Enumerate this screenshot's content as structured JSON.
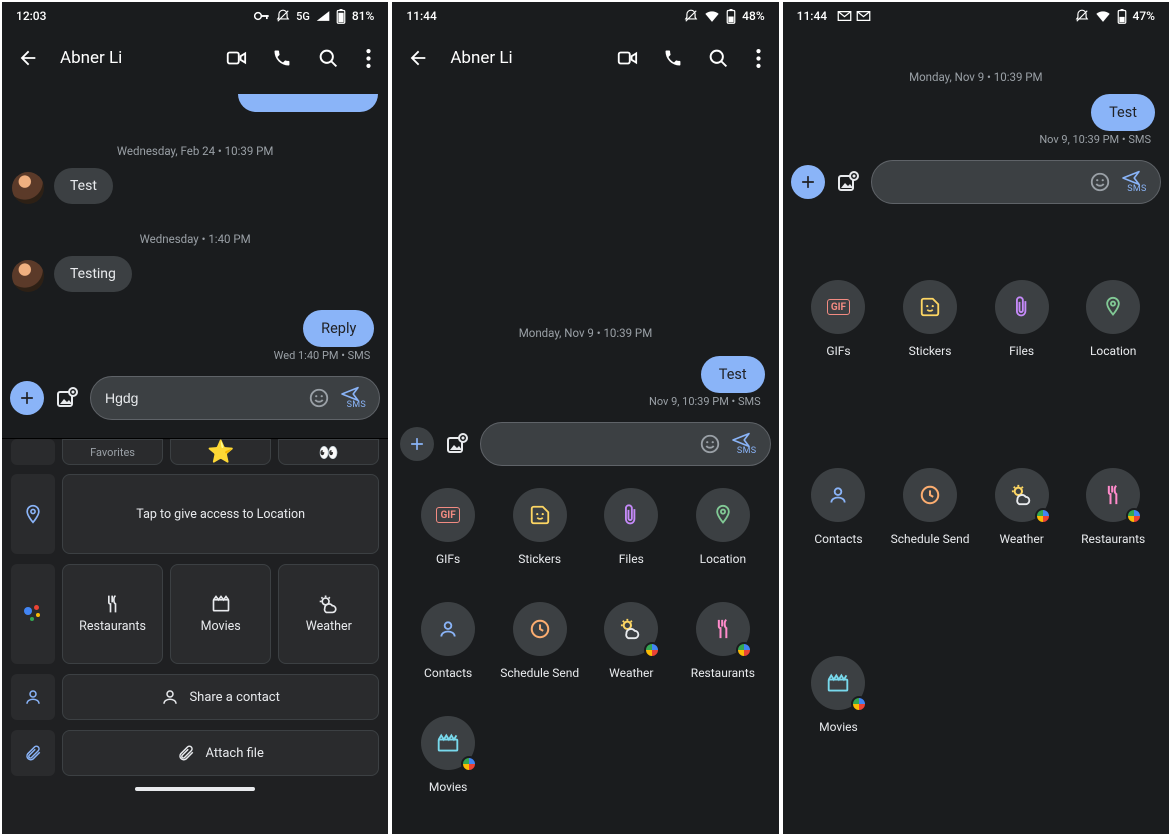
{
  "screen1": {
    "status": {
      "time": "12:03",
      "net": "5G",
      "battery": "81%"
    },
    "contact": "Abner Li",
    "date1": "Wednesday, Feb 24 • 10:39 PM",
    "msg1": "Test",
    "date2": "Wednesday • 1:40 PM",
    "msg2": "Testing",
    "reply": "Reply",
    "reply_meta": "Wed 1:40 PM • SMS",
    "input_value": "Hgdg",
    "send_label": "SMS",
    "panel": {
      "favorites": "Favorites",
      "location_prompt": "Tap to give access to Location",
      "restaurants": "Restaurants",
      "movies": "Movies",
      "weather": "Weather",
      "share_contact": "Share a contact",
      "attach_file": "Attach file"
    }
  },
  "screen2": {
    "status": {
      "time": "11:44",
      "battery": "48%"
    },
    "contact": "Abner Li",
    "date1": "Monday, Nov 9 • 10:39 PM",
    "msg_sent": "Test",
    "sent_meta": "Nov 9, 10:39 PM • SMS",
    "send_label": "SMS",
    "grid": {
      "gifs": "GIFs",
      "stickers": "Stickers",
      "files": "Files",
      "location": "Location",
      "contacts": "Contacts",
      "schedule": "Schedule Send",
      "weather": "Weather",
      "restaurants": "Restaurants",
      "movies": "Movies"
    }
  },
  "screen3": {
    "status": {
      "time": "11:44",
      "battery": "47%"
    },
    "date1": "Monday, Nov 9 • 10:39 PM",
    "msg_sent": "Test",
    "sent_meta": "Nov 9, 10:39 PM • SMS",
    "send_label": "SMS",
    "grid": {
      "gifs": "GIFs",
      "stickers": "Stickers",
      "files": "Files",
      "location": "Location",
      "contacts": "Contacts",
      "schedule": "Schedule Send",
      "weather": "Weather",
      "restaurants": "Restaurants",
      "movies": "Movies"
    }
  }
}
